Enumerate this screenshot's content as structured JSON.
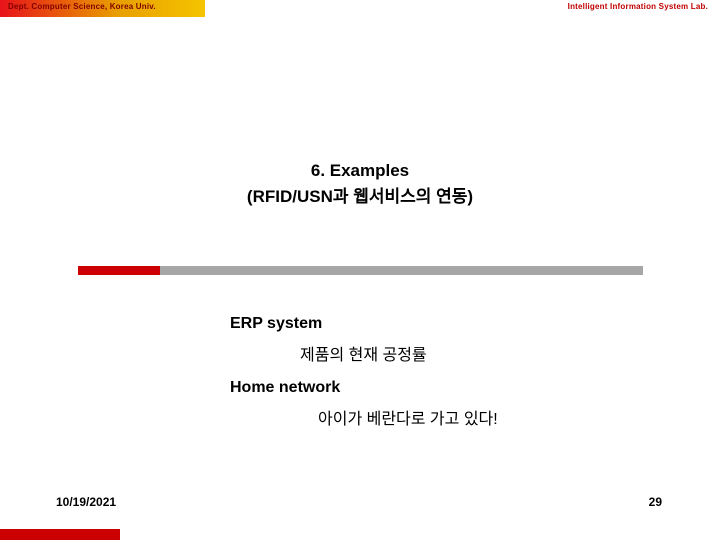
{
  "header": {
    "left_text": "Dept. Computer Science, Korea Univ.",
    "right_text": "Intelligent Information System Lab."
  },
  "title": {
    "line1": "6. Examples",
    "line2": "(RFID/USN과 웹서비스의 연동)"
  },
  "body": {
    "item1_label": "ERP system",
    "item1_value": "제품의 현재 공정률",
    "item2_label": "Home network",
    "item2_value": "아이가 베란다로 가고 있다!"
  },
  "footer": {
    "date": "10/19/2021",
    "page_number": "29"
  },
  "colors": {
    "accent_red": "#cc0000",
    "header_left": "#7f0000",
    "header_right": "#c00000",
    "separator_gray": "#a6a6a6"
  }
}
